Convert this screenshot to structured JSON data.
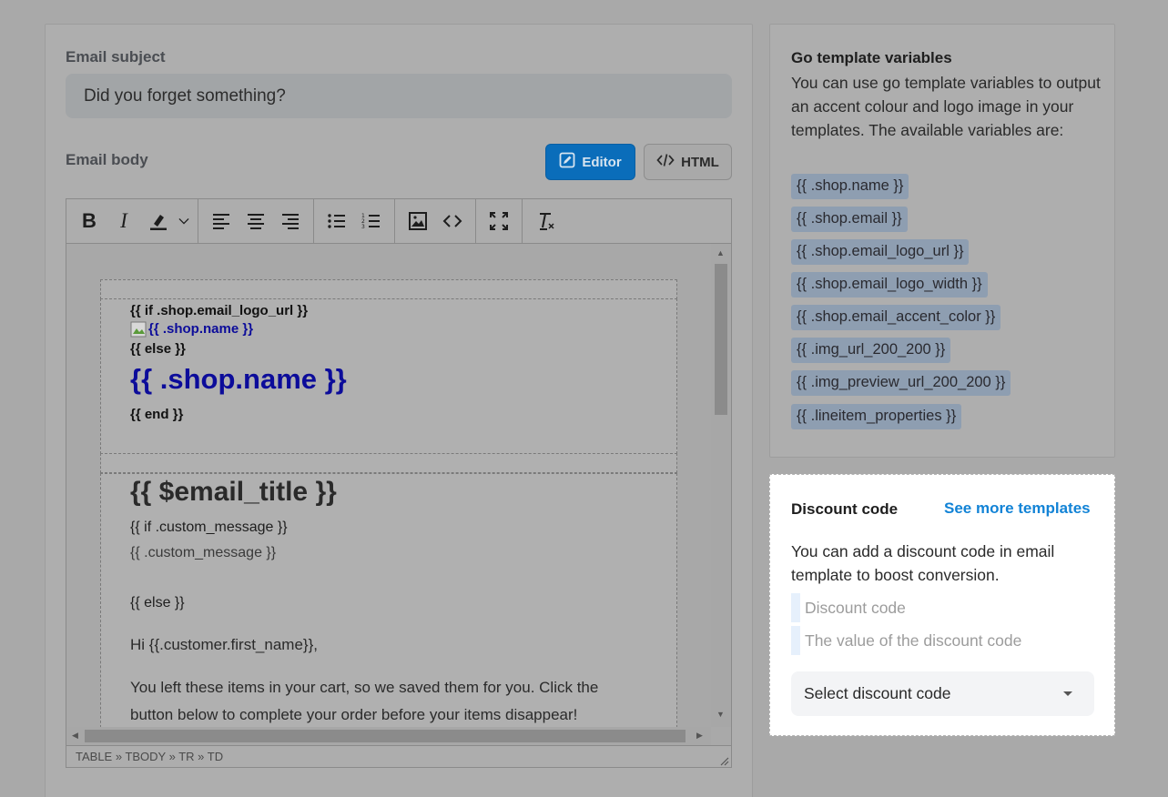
{
  "subject": {
    "label": "Email subject",
    "value": "Did you forget something?"
  },
  "body": {
    "label": "Email body",
    "editor_btn": "Editor",
    "html_btn": "HTML"
  },
  "editor_content": {
    "if_logo": "{{ if .shop.email_logo_url }}",
    "logo_alt": "{{ .shop.name }}",
    "else1": "{{ else }}",
    "shop_name": "{{ .shop.name }}",
    "end": "{{ end }}",
    "email_title": "{{ $email_title }}",
    "if_custom": "{{ if .custom_message }}",
    "custom_message": "{{ .custom_message }}",
    "else2": "{{ else }}",
    "greeting": "Hi {{.customer.first_name}},",
    "body_line1": "You left these items in your cart, so we saved them for you. Click the",
    "body_line2": "button below to complete your order before your items disappear!"
  },
  "statusbar": "TABLE » TBODY » TR » TD",
  "variables": {
    "title": "Go template variables",
    "desc": "You can use go template variables to output an accent colour and logo image in your templates. The available variables are:",
    "items": [
      "{{ .shop.name }}",
      "{{ .shop.email }}",
      "{{ .shop.email_logo_url }}",
      "{{ .shop.email_logo_width }}",
      "{{ .shop.email_accent_color }}",
      "{{ .img_url_200_200 }}",
      "{{ .img_preview_url_200_200 }}",
      "{{ .lineitem_properties }}"
    ]
  },
  "discount": {
    "title": "Discount code",
    "link": "See more templates",
    "desc": "You can add a discount code in email template to boost conversion.",
    "code_placeholder": "Discount code",
    "value_placeholder": "The value of the discount code",
    "select_label": "Select discount code"
  }
}
